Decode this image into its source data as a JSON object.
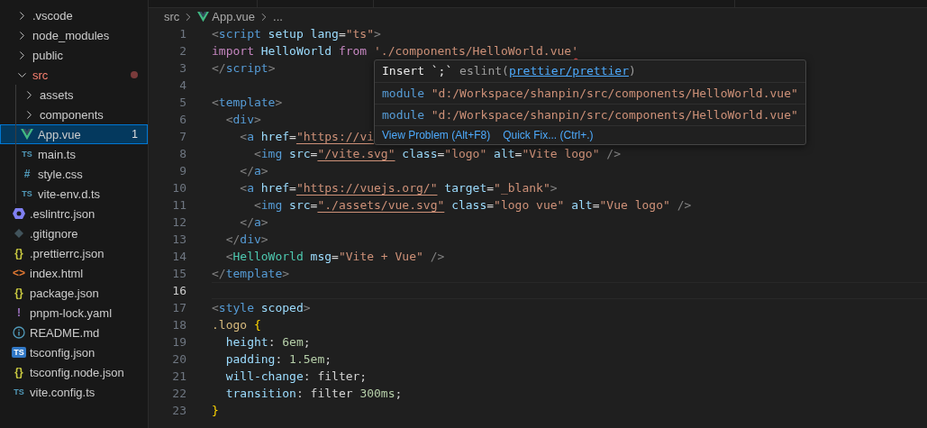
{
  "explorer": {
    "items": [
      {
        "label": ".vscode",
        "kind": "folder",
        "expanded": false,
        "selected": false
      },
      {
        "label": "node_modules",
        "kind": "folder",
        "expanded": false,
        "selected": false
      },
      {
        "label": "public",
        "kind": "folder",
        "expanded": false,
        "selected": false
      },
      {
        "label": "src",
        "kind": "folder",
        "expanded": true,
        "selected": false,
        "has_problems": true,
        "children": [
          {
            "label": "assets",
            "kind": "folder",
            "expanded": false,
            "selected": false
          },
          {
            "label": "components",
            "kind": "folder",
            "expanded": false,
            "selected": false
          },
          {
            "label": "App.vue",
            "kind": "vue",
            "selected": true,
            "badge": "1"
          },
          {
            "label": "main.ts",
            "kind": "ts",
            "glyph": "TS",
            "selected": false
          },
          {
            "label": "style.css",
            "kind": "css",
            "glyph": "#",
            "selected": false
          },
          {
            "label": "vite-env.d.ts",
            "kind": "ts",
            "glyph": "TS",
            "selected": false
          }
        ]
      },
      {
        "label": ".eslintrc.json",
        "kind": "eslint",
        "selected": false
      },
      {
        "label": ".gitignore",
        "kind": "git",
        "selected": false
      },
      {
        "label": ".prettierrc.json",
        "kind": "json",
        "glyph": "{}",
        "selected": false
      },
      {
        "label": "index.html",
        "kind": "html",
        "glyph": "<>",
        "selected": false
      },
      {
        "label": "package.json",
        "kind": "json",
        "glyph": "{}",
        "selected": false
      },
      {
        "label": "pnpm-lock.yaml",
        "kind": "yaml",
        "glyph": "!",
        "selected": false
      },
      {
        "label": "README.md",
        "kind": "info",
        "selected": false
      },
      {
        "label": "tsconfig.json",
        "kind": "tsconfig",
        "glyph": "TS",
        "selected": false
      },
      {
        "label": "tsconfig.node.json",
        "kind": "json",
        "glyph": "{}",
        "selected": false
      },
      {
        "label": "vite.config.ts",
        "kind": "ts",
        "glyph": "TS",
        "selected": false
      }
    ]
  },
  "breadcrumb": {
    "folder": "src",
    "file": "App.vue",
    "more": "..."
  },
  "editor": {
    "lines": [
      {
        "number": "1",
        "selected": false,
        "tokens": [
          {
            "t": "<",
            "kind": "punct"
          },
          {
            "t": "script",
            "kind": "tag"
          },
          {
            "t": " setup lang",
            "kind": "attr"
          },
          {
            "t": "=",
            "kind": "plain"
          },
          {
            "t": "\"ts\"",
            "kind": "str"
          },
          {
            "t": ">",
            "kind": "punct"
          }
        ]
      },
      {
        "number": "2",
        "selected": false,
        "tokens": [
          {
            "t": "import",
            "kind": "keyword"
          },
          {
            "t": " HelloWorld ",
            "kind": "var"
          },
          {
            "t": "from",
            "kind": "keyword"
          },
          {
            "t": " './components/HelloWorld.vue",
            "kind": "str"
          },
          {
            "t": "'",
            "kind": "error"
          }
        ]
      },
      {
        "number": "3",
        "selected": false,
        "tokens": [
          {
            "t": "</",
            "kind": "punct"
          },
          {
            "t": "script",
            "kind": "tag"
          },
          {
            "t": ">",
            "kind": "punct"
          }
        ]
      },
      {
        "number": "4",
        "selected": false
      },
      {
        "number": "5",
        "selected": false,
        "tokens": [
          {
            "t": "<",
            "kind": "punct"
          },
          {
            "t": "template",
            "kind": "tag"
          },
          {
            "t": ">",
            "kind": "punct"
          }
        ]
      },
      {
        "number": "6",
        "selected": false,
        "tokens": [
          {
            "t": "  <",
            "kind": "punct"
          },
          {
            "t": "div",
            "kind": "tag"
          },
          {
            "t": ">",
            "kind": "punct"
          }
        ]
      },
      {
        "number": "7",
        "selected": false,
        "tokens": [
          {
            "t": "    <",
            "kind": "punct"
          },
          {
            "t": "a",
            "kind": "tag"
          },
          {
            "t": " href",
            "kind": "attr"
          },
          {
            "t": "=",
            "kind": "plain"
          },
          {
            "t": "\"https://vi",
            "kind": "link"
          }
        ]
      },
      {
        "number": "8",
        "selected": false,
        "tokens": [
          {
            "t": "      <",
            "kind": "punct"
          },
          {
            "t": "img",
            "kind": "tag"
          },
          {
            "t": " src",
            "kind": "attr"
          },
          {
            "t": "=",
            "kind": "plain"
          },
          {
            "t": "\"/vite.svg\"",
            "kind": "link"
          },
          {
            "t": " class",
            "kind": "attr"
          },
          {
            "t": "=",
            "kind": "plain"
          },
          {
            "t": "\"logo\"",
            "kind": "str"
          },
          {
            "t": " alt",
            "kind": "attr"
          },
          {
            "t": "=",
            "kind": "plain"
          },
          {
            "t": "\"Vite logo\"",
            "kind": "str"
          },
          {
            "t": " />",
            "kind": "punct"
          }
        ]
      },
      {
        "number": "9",
        "selected": false,
        "tokens": [
          {
            "t": "    </",
            "kind": "punct"
          },
          {
            "t": "a",
            "kind": "tag"
          },
          {
            "t": ">",
            "kind": "punct"
          }
        ]
      },
      {
        "number": "10",
        "selected": false,
        "tokens": [
          {
            "t": "    <",
            "kind": "punct"
          },
          {
            "t": "a",
            "kind": "tag"
          },
          {
            "t": " href",
            "kind": "attr"
          },
          {
            "t": "=",
            "kind": "plain"
          },
          {
            "t": "\"https://vuejs.org/\"",
            "kind": "link"
          },
          {
            "t": " target",
            "kind": "attr"
          },
          {
            "t": "=",
            "kind": "plain"
          },
          {
            "t": "\"_blank\"",
            "kind": "str"
          },
          {
            "t": ">",
            "kind": "punct"
          }
        ]
      },
      {
        "number": "11",
        "selected": false,
        "tokens": [
          {
            "t": "      <",
            "kind": "punct"
          },
          {
            "t": "img",
            "kind": "tag"
          },
          {
            "t": " src",
            "kind": "attr"
          },
          {
            "t": "=",
            "kind": "plain"
          },
          {
            "t": "\"./assets/vue.svg\"",
            "kind": "link"
          },
          {
            "t": " class",
            "kind": "attr"
          },
          {
            "t": "=",
            "kind": "plain"
          },
          {
            "t": "\"logo vue\"",
            "kind": "str"
          },
          {
            "t": " alt",
            "kind": "attr"
          },
          {
            "t": "=",
            "kind": "plain"
          },
          {
            "t": "\"Vue logo\"",
            "kind": "str"
          },
          {
            "t": " />",
            "kind": "punct"
          }
        ]
      },
      {
        "number": "12",
        "selected": false,
        "tokens": [
          {
            "t": "    </",
            "kind": "punct"
          },
          {
            "t": "a",
            "kind": "tag"
          },
          {
            "t": ">",
            "kind": "punct"
          }
        ]
      },
      {
        "number": "13",
        "selected": false,
        "tokens": [
          {
            "t": "  </",
            "kind": "punct"
          },
          {
            "t": "div",
            "kind": "tag"
          },
          {
            "t": ">",
            "kind": "punct"
          }
        ]
      },
      {
        "number": "14",
        "selected": false,
        "tokens": [
          {
            "t": "  <",
            "kind": "punct"
          },
          {
            "t": "HelloWorld",
            "kind": "comp"
          },
          {
            "t": " msg",
            "kind": "attr"
          },
          {
            "t": "=",
            "kind": "plain"
          },
          {
            "t": "\"Vite + Vue\"",
            "kind": "str"
          },
          {
            "t": " />",
            "kind": "punct"
          }
        ]
      },
      {
        "number": "15",
        "selected": false,
        "tokens": [
          {
            "t": "</",
            "kind": "punct"
          },
          {
            "t": "template",
            "kind": "tag"
          },
          {
            "t": ">",
            "kind": "punct"
          }
        ]
      },
      {
        "number": "16",
        "selected": true
      },
      {
        "number": "17",
        "selected": false,
        "tokens": [
          {
            "t": "<",
            "kind": "punct"
          },
          {
            "t": "style",
            "kind": "tag"
          },
          {
            "t": " scoped",
            "kind": "attr"
          },
          {
            "t": ">",
            "kind": "punct"
          }
        ]
      },
      {
        "number": "18",
        "selected": false,
        "tokens": [
          {
            "t": ".logo ",
            "kind": "sel"
          },
          {
            "t": "{",
            "kind": "brace"
          }
        ]
      },
      {
        "number": "19",
        "selected": false,
        "tokens": [
          {
            "t": "  height",
            "kind": "attr"
          },
          {
            "t": ": ",
            "kind": "plain"
          },
          {
            "t": "6em",
            "kind": "num"
          },
          {
            "t": ";",
            "kind": "plain"
          }
        ]
      },
      {
        "number": "20",
        "selected": false,
        "tokens": [
          {
            "t": "  padding",
            "kind": "attr"
          },
          {
            "t": ": ",
            "kind": "plain"
          },
          {
            "t": "1.5em",
            "kind": "num"
          },
          {
            "t": ";",
            "kind": "plain"
          }
        ]
      },
      {
        "number": "21",
        "selected": false,
        "tokens": [
          {
            "t": "  will-change",
            "kind": "attr"
          },
          {
            "t": ": filter;",
            "kind": "plain"
          }
        ]
      },
      {
        "number": "22",
        "selected": false,
        "tokens": [
          {
            "t": "  transition",
            "kind": "attr"
          },
          {
            "t": ": filter ",
            "kind": "plain"
          },
          {
            "t": "300ms",
            "kind": "num"
          },
          {
            "t": ";",
            "kind": "plain"
          }
        ]
      },
      {
        "number": "23",
        "selected": false,
        "tokens": [
          {
            "t": "}",
            "kind": "brace"
          }
        ]
      }
    ]
  },
  "hover": {
    "message": "Insert `;`",
    "source_prefix": "eslint(",
    "source_link": "prettier/prettier",
    "source_suffix": ")",
    "details": [
      {
        "keyword": "module",
        "text": " \"d:/Workspace/shanpin/src/components/HelloWorld.vue\""
      },
      {
        "keyword": "module",
        "text": " \"d:/Workspace/shanpin/src/components/HelloWorld.vue\""
      }
    ],
    "actions": [
      "View Problem (Alt+F8)",
      "Quick Fix... (Ctrl+.)"
    ]
  }
}
